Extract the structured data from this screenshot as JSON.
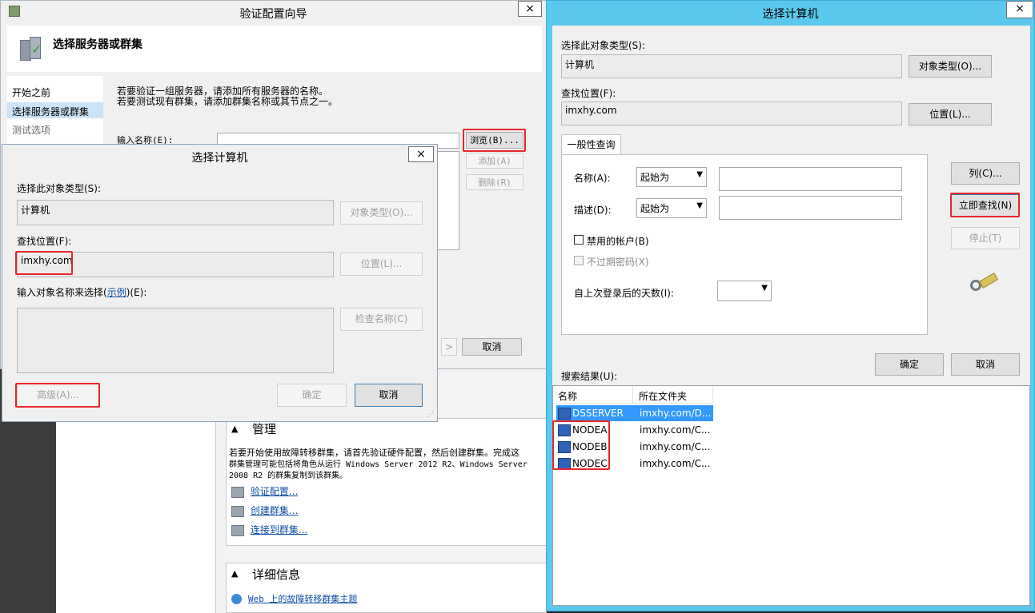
{
  "wizard": {
    "title": "验证配置向导",
    "heading": "选择服务器或群集",
    "nav": [
      "开始之前",
      "选择服务器或群集",
      "测试选项"
    ],
    "desc_line1": "若要验证一组服务器，请添加所有服务器的名称。",
    "desc_line2": "若要测试现有群集，请添加群集名称或其节点之一。",
    "enter_name_label": "输入名称(E):",
    "browse_label": "浏览(B)...",
    "add_label": "添加(A)",
    "remove_label": "删除(R)",
    "next_arrow": ">",
    "cancel_label": "取消"
  },
  "background_console": {
    "manage_header": "管理",
    "manage_text1": "若要开始使用故障转移群集，请首先验证硬件配置，然后创建群集。完成这",
    "manage_text2": "群集管理可能包括将角色从运行 Windows Server 2012 R2、Windows Server",
    "manage_text3": "2008 R2 的群集复制到该群集。",
    "links": [
      "验证配置...",
      "创建群集...",
      "连接到群集..."
    ],
    "details_header": "详细信息",
    "details_link": "Web 上的故障转移群集主题",
    "close_x": "×"
  },
  "small_dialog": {
    "title": "选择计算机",
    "object_type_label": "选择此对象类型(S):",
    "object_type_value": "计算机",
    "object_type_btn": "对象类型(O)...",
    "location_label": "查找位置(F):",
    "location_value": "imxhy.com",
    "location_btn": "位置(L)...",
    "enter_names_prefix": "输入对象名称来选择(",
    "enter_names_link": "示例",
    "enter_names_suffix": ")(E):",
    "check_names_btn": "检查名称(C)",
    "advanced_btn": "高级(A)...",
    "ok_btn": "确定",
    "cancel_btn": "取消",
    "close_x": "×"
  },
  "big_dialog": {
    "title": "选择计算机",
    "object_type_label": "选择此对象类型(S):",
    "object_type_value": "计算机",
    "object_type_btn": "对象类型(O)...",
    "location_label": "查找位置(F):",
    "location_value": "imxhy.com",
    "location_btn": "位置(L)...",
    "tab_label": "一般性查询",
    "name_label": "名称(A):",
    "name_mode": "起始为",
    "desc_label": "描述(D):",
    "desc_mode": "起始为",
    "disabled_accounts": "禁用的帐户(B)",
    "non_expiring": "不过期密码(X)",
    "days_label": "自上次登录后的天数(I):",
    "columns_btn": "列(C)...",
    "find_now_btn": "立即查找(N)",
    "stop_btn": "停止(T)",
    "ok_btn": "确定",
    "cancel_btn": "取消",
    "results_label": "搜索结果(U):",
    "columns": [
      "名称",
      "所在文件夹"
    ],
    "rows": [
      {
        "name": "DSSERVER",
        "folder": "imxhy.com/D..."
      },
      {
        "name": "NODEA",
        "folder": "imxhy.com/C..."
      },
      {
        "name": "NODEB",
        "folder": "imxhy.com/C..."
      },
      {
        "name": "NODEC",
        "folder": "imxhy.com/C..."
      }
    ],
    "close_x": "×",
    "titlebar_color": "#5bc9ee",
    "highlight_color": "#e8262b",
    "selection_color": "#3399ff"
  }
}
